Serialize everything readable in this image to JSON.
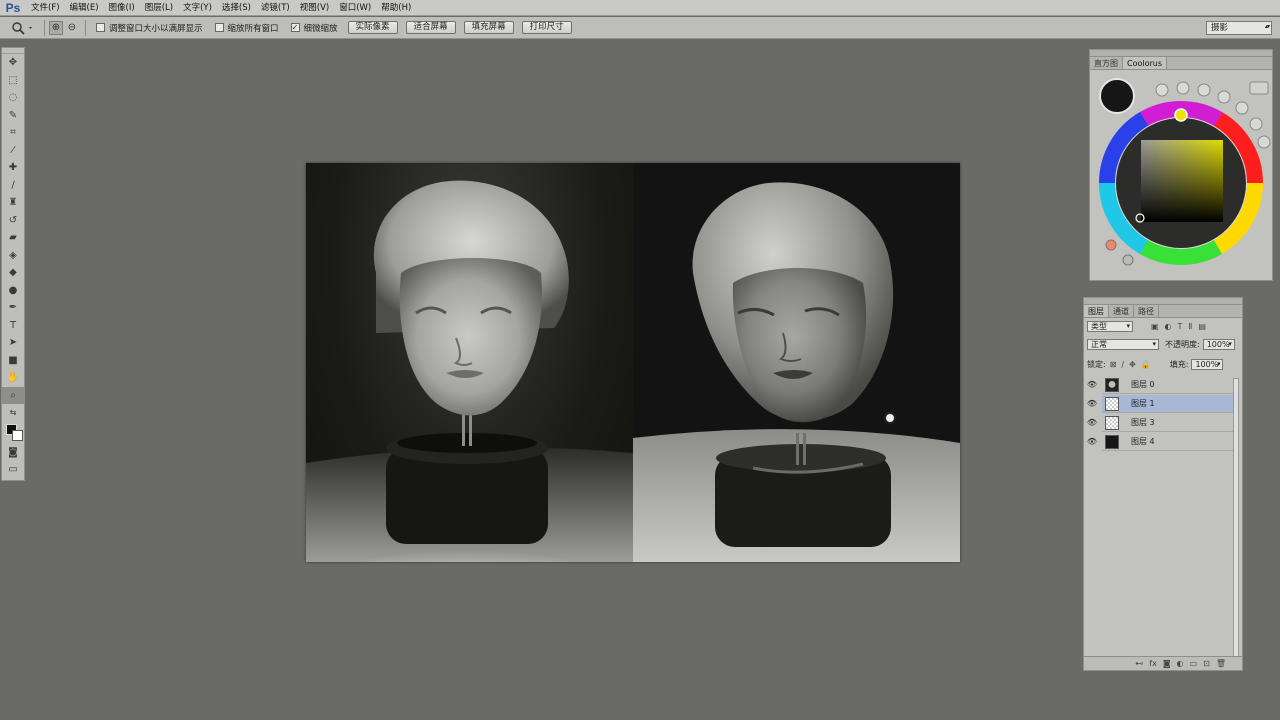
{
  "app": {
    "logo": "Ps"
  },
  "menu": [
    "文件(F)",
    "编辑(E)",
    "图像(I)",
    "图层(L)",
    "文字(Y)",
    "选择(S)",
    "滤镜(T)",
    "视图(V)",
    "窗口(W)",
    "帮助(H)"
  ],
  "options": {
    "checkbox_resize": "调整窗口大小以满屏显示",
    "checkbox_zoom_all": "缩放所有窗口",
    "checkbox_scrubby": "细微缩放",
    "btn_actual": "实际像素",
    "btn_fit": "适合屏幕",
    "btn_fill": "填充屏幕",
    "btn_print": "打印尺寸",
    "workspace": "摄影"
  },
  "color_panel": {
    "tabs": [
      "直方图",
      "Coolorus"
    ],
    "foreground": "#161616",
    "hue": "#e4e000"
  },
  "layers_panel": {
    "tabs": [
      "图层",
      "通道",
      "路径"
    ],
    "filter": "类型",
    "blend_mode": "正常",
    "opacity_label": "不透明度:",
    "opacity": "100%",
    "lock_label": "锁定:",
    "fill_label": "填充:",
    "fill": "100%",
    "layers": [
      {
        "name": "图层 0",
        "thumb": "head",
        "selected": false
      },
      {
        "name": "图层 1",
        "thumb": "checker",
        "selected": true
      },
      {
        "name": "图层 3",
        "thumb": "checker",
        "selected": false
      },
      {
        "name": "图层 4",
        "thumb": "dark",
        "selected": false
      }
    ]
  }
}
